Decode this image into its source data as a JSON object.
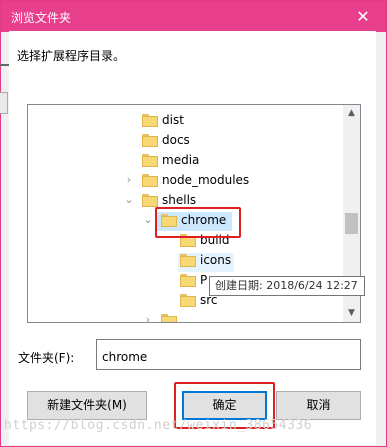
{
  "window": {
    "title": "浏览文件夹",
    "close_glyph": "✕"
  },
  "instruction": "选择扩展程序目录。",
  "tree": {
    "nodes": [
      {
        "label": "dist",
        "expander": ""
      },
      {
        "label": "docs",
        "expander": ""
      },
      {
        "label": "media",
        "expander": ""
      },
      {
        "label": "node_modules",
        "expander": "›"
      },
      {
        "label": "shells",
        "expander": "⌄"
      },
      {
        "label": "chrome",
        "expander": "⌄",
        "selected": true
      },
      {
        "label": "build",
        "expander": ""
      },
      {
        "label": "icons",
        "expander": "",
        "hovered": true
      },
      {
        "label": "P",
        "expander": ""
      },
      {
        "label": "src",
        "expander": ""
      },
      {
        "label": "",
        "expander": "›"
      }
    ],
    "scroll_up": "▲",
    "scroll_down": "▼"
  },
  "tooltip": "创建日期: 2018/6/24 12:27",
  "folder_field": {
    "label": "文件夹(F):",
    "value": "chrome"
  },
  "buttons": {
    "new_folder": "新建文件夹(M)",
    "ok": "确定",
    "cancel": "取消"
  },
  "watermark": "https://blog.csdn.net/weixin_38654336",
  "colors": {
    "titlebar": "#e83f8c",
    "selection": "#cce8ff",
    "highlight_box": "#e02020",
    "default_button_border": "#0078d7"
  }
}
